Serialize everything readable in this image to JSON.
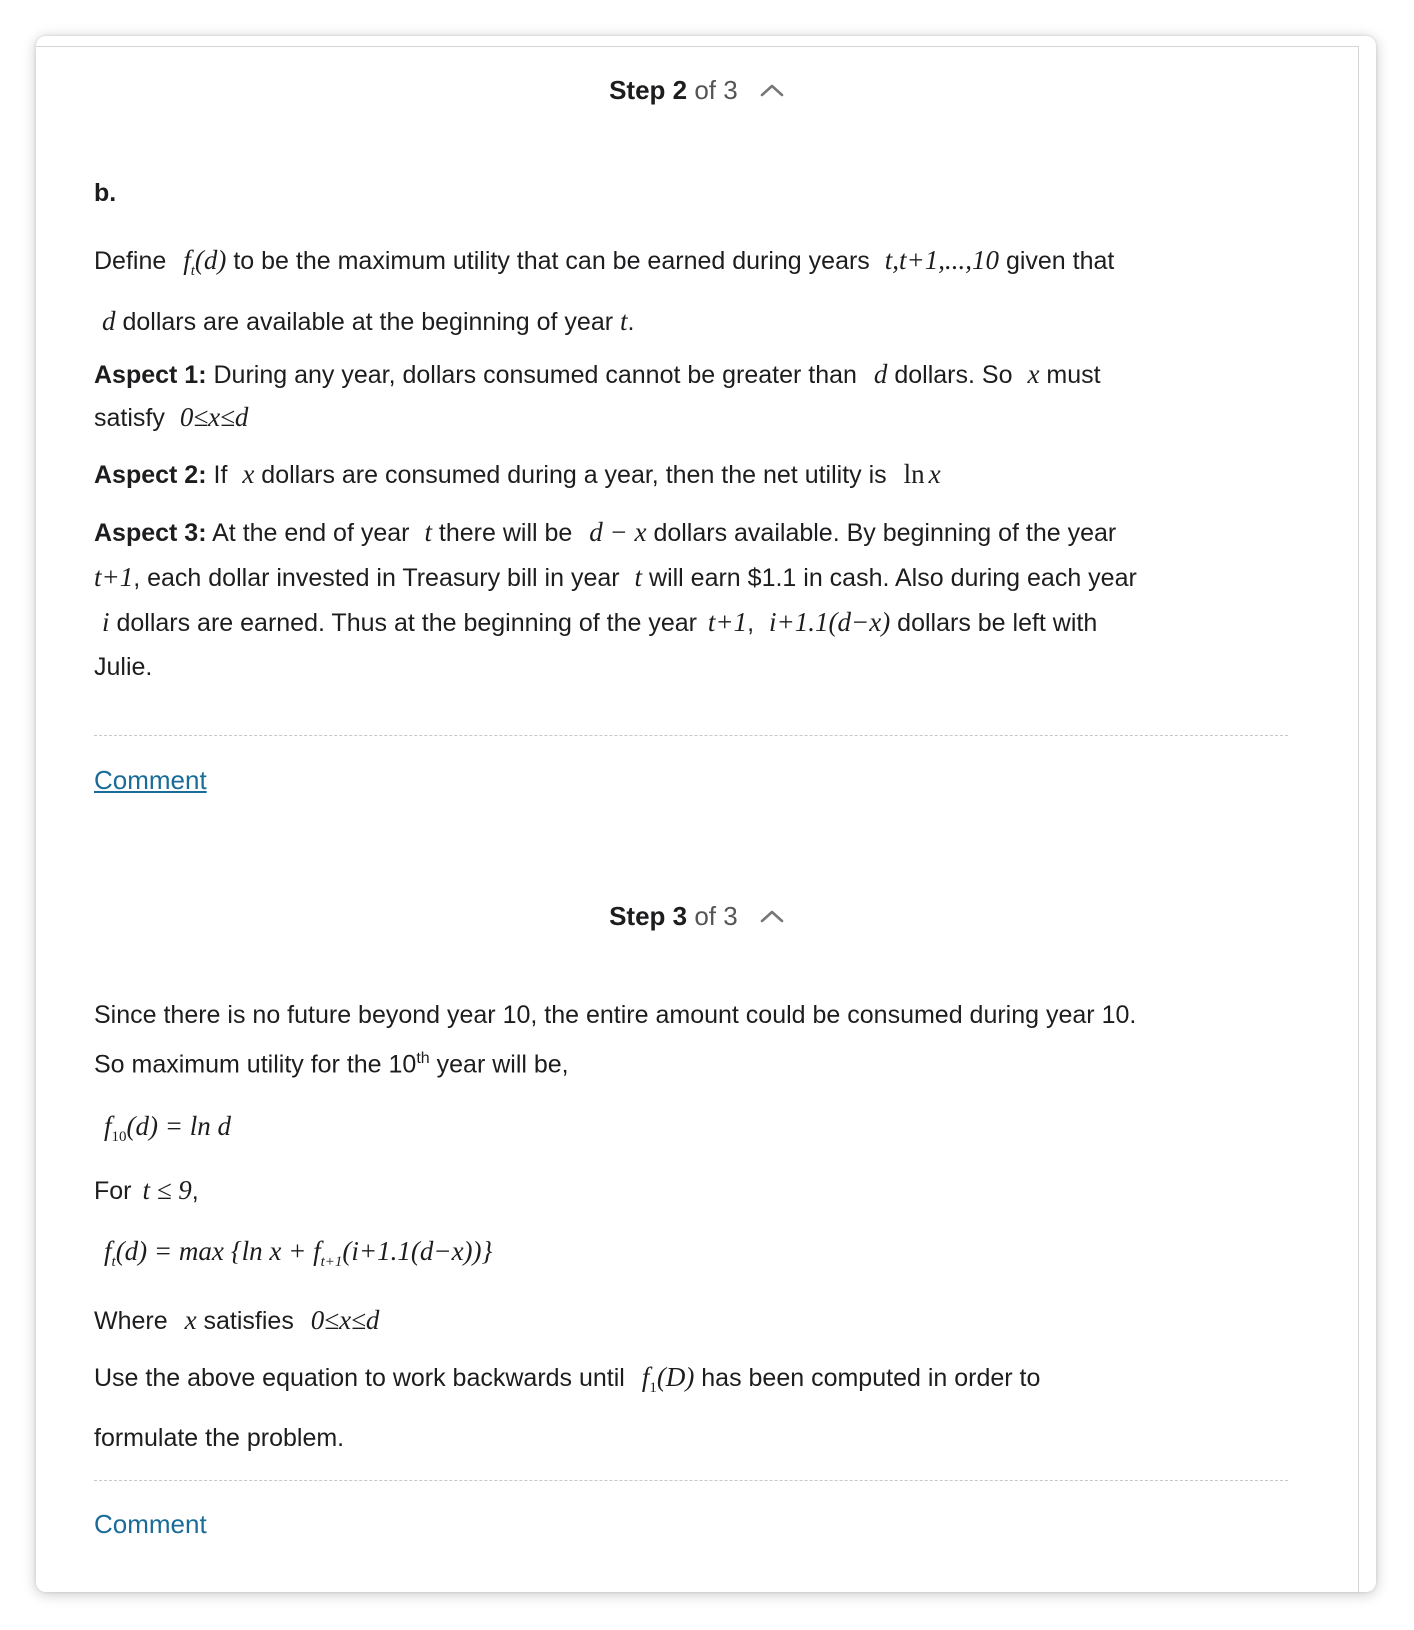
{
  "step2": {
    "header_strong": "Step 2",
    "header_of": "of 3",
    "label": "b.",
    "define_intro": "Define",
    "define_f": "f",
    "define_sub": "t",
    "define_arg": "(d)",
    "define_mid": "to be the maximum utility that can be earned during years",
    "define_years": "t,t+1,...,10",
    "define_tail": "given that",
    "line2_d": "d",
    "line2_text": "dollars are available at the beginning of year",
    "line2_t": "t",
    "line2_end": ".",
    "a1_label": "Aspect 1:",
    "a1_text": "During any year, dollars consumed cannot be greater than",
    "a1_d": "d",
    "a1_text2": "dollars. So",
    "a1_x": "x",
    "a1_text3": "must",
    "a1_text4": "satisfy",
    "a1_ineq": "0≤x≤d",
    "a2_label": "Aspect 2:",
    "a2_text": "If",
    "a2_x": "x",
    "a2_text2": "dollars are consumed during a year, then the net utility is",
    "a2_ln": "ln",
    "a2_lnx": "x",
    "a3_label": "Aspect 3:",
    "a3_text": "At the end of year",
    "a3_t": "t",
    "a3_text2": "there will be",
    "a3_dx": "d − x",
    "a3_text3": "dollars available. By beginning of the year",
    "a3_t1": "t+1",
    "a3_text4": ", each dollar invested in Treasury bill in year",
    "a3_t2": "t",
    "a3_text5": "will earn $1.1 in cash. Also during each year",
    "a3_i": "i",
    "a3_text6": "dollars are earned. Thus at the beginning of the year",
    "a3_t3": "t+1",
    "a3_comma": ",",
    "a3_expr": "i+1.1(d−x)",
    "a3_text7": "dollars be left with",
    "a3_text8": "Julie.",
    "comment": "Comment"
  },
  "step3": {
    "header_strong": "Step 3",
    "header_of": "of 3",
    "p1": "Since there is no future beyond year 10, the entire amount could be consumed during year 10.",
    "p2a": "So maximum utility for the 10",
    "p2sup": "th",
    "p2b": " year will be,",
    "eq1_f": "f",
    "eq1_sub": "10",
    "eq1_rest": "(d) = ln d",
    "for_text": "For",
    "for_cond": "t ≤ 9",
    "for_comma": ",",
    "eq2_f": "f",
    "eq2_sub": "t",
    "eq2_a": "(d) = max",
    "eq2_b": "{ln x + f",
    "eq2_sub2": "t+1",
    "eq2_c": "(i+1.1(d−x))}",
    "where": "Where",
    "where_x": "x",
    "satisfies": "satisfies",
    "where_ineq": "0≤x≤d",
    "use_a": "Use the above equation to work backwards until",
    "use_f": "f",
    "use_sub": "1",
    "use_arg": "(D)",
    "use_b": "has been computed in order to",
    "use_c": "formulate the problem.",
    "comment": "Comment"
  }
}
